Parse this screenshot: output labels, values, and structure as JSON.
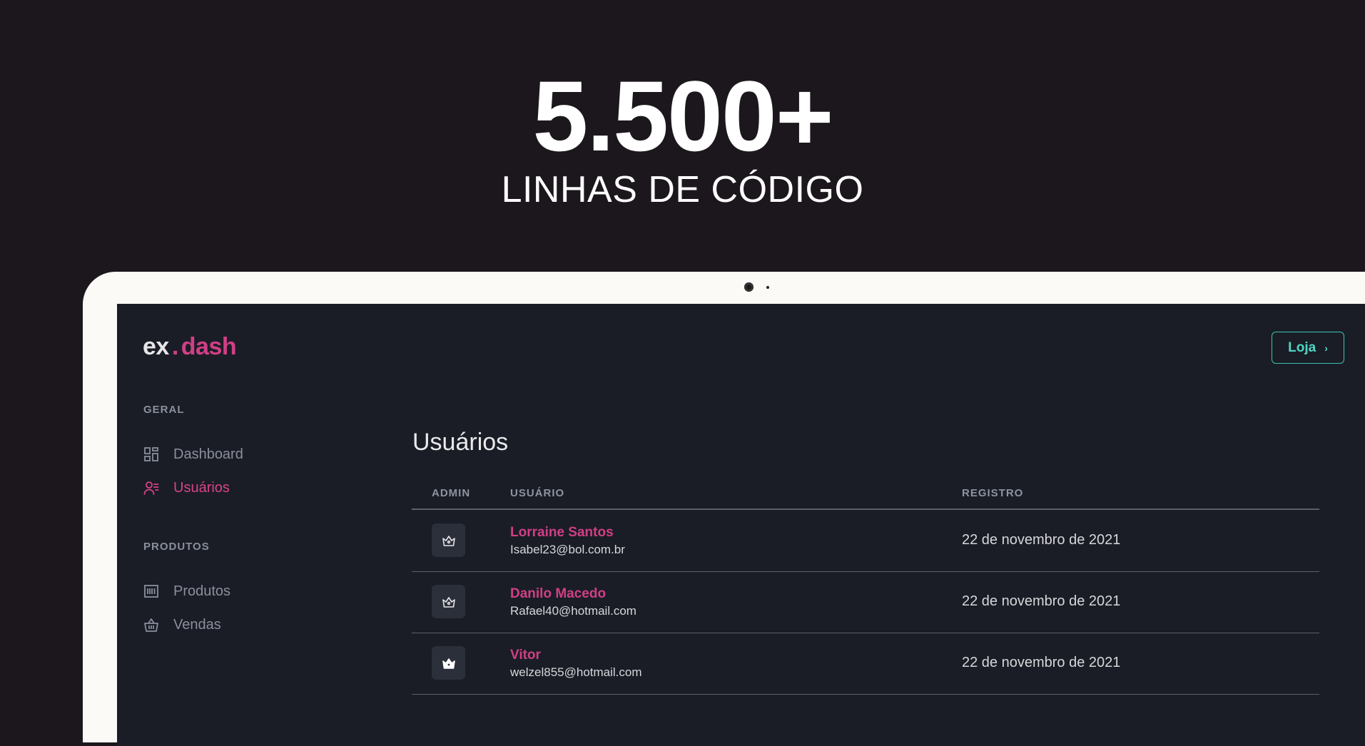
{
  "hero": {
    "number": "5.500+",
    "caption": "LINHAS DE CÓDIGO"
  },
  "app": {
    "logo": {
      "ex": "ex",
      "dot": ".",
      "dash": "dash"
    },
    "store_button": {
      "label": "Loja",
      "icon": "chevron-right-icon"
    },
    "sidebar": {
      "sections": [
        {
          "title": "GERAL",
          "items": [
            {
              "label": "Dashboard",
              "icon": "dashboard-grid-icon",
              "active": false
            },
            {
              "label": "Usuários",
              "icon": "users-list-icon",
              "active": true
            }
          ]
        },
        {
          "title": "PRODUTOS",
          "items": [
            {
              "label": "Produtos",
              "icon": "barcode-icon",
              "active": false
            },
            {
              "label": "Vendas",
              "icon": "basket-icon",
              "active": false
            }
          ]
        }
      ]
    },
    "main": {
      "title": "Usuários",
      "table": {
        "columns": [
          "ADMIN",
          "USUÁRIO",
          "REGISTRO"
        ],
        "rows": [
          {
            "admin": false,
            "name": "Lorraine Santos",
            "email": "Isabel23@bol.com.br",
            "date": "22 de novembro de 2021"
          },
          {
            "admin": false,
            "name": "Danilo Macedo",
            "email": "Rafael40@hotmail.com",
            "date": "22 de novembro de 2021"
          },
          {
            "admin": true,
            "name": "Vitor",
            "email": "welzel855@hotmail.com",
            "date": "22 de novembro de 2021"
          }
        ]
      }
    }
  },
  "colors": {
    "background": "#1c171c",
    "screen": "#1a1d26",
    "accent_pink": "#d13f86",
    "accent_teal": "#52d6c4"
  }
}
